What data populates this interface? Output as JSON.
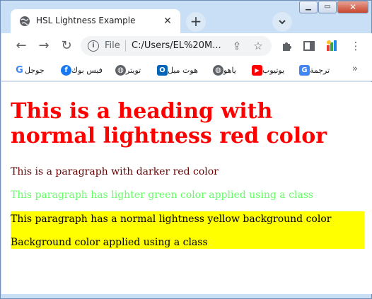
{
  "browser": {
    "tab_title": "HSL Lightness Example",
    "url_scheme": "File",
    "url": "C:/Users/EL%20M...",
    "bookmarks": [
      {
        "label": "جوجل",
        "icon": "google-icon"
      },
      {
        "label": "فيس بوك",
        "icon": "facebook-icon"
      },
      {
        "label": "تويتر",
        "icon": "globe-icon"
      },
      {
        "label": "هوت ميل",
        "icon": "outlook-icon"
      },
      {
        "label": "ياهو",
        "icon": "globe-icon"
      },
      {
        "label": "يوتيوب",
        "icon": "youtube-icon"
      },
      {
        "label": "ترجمة",
        "icon": "google-translate-icon"
      }
    ],
    "more_bookmarks": "»"
  },
  "page": {
    "heading": "This is a heading with normal lightness red color",
    "p_dark": "This is a paragraph with darker red color",
    "p_light": "This paragraph has lighter green color applied using a class",
    "p_yellow_1": "This paragraph has a normal lightness yellow background color",
    "p_yellow_2": "Background color applied using a class"
  },
  "colors": {
    "heading": "#ff0000",
    "dark_red": "#660000",
    "light_green": "#66ff66",
    "yellow_bg": "#ffff00"
  }
}
